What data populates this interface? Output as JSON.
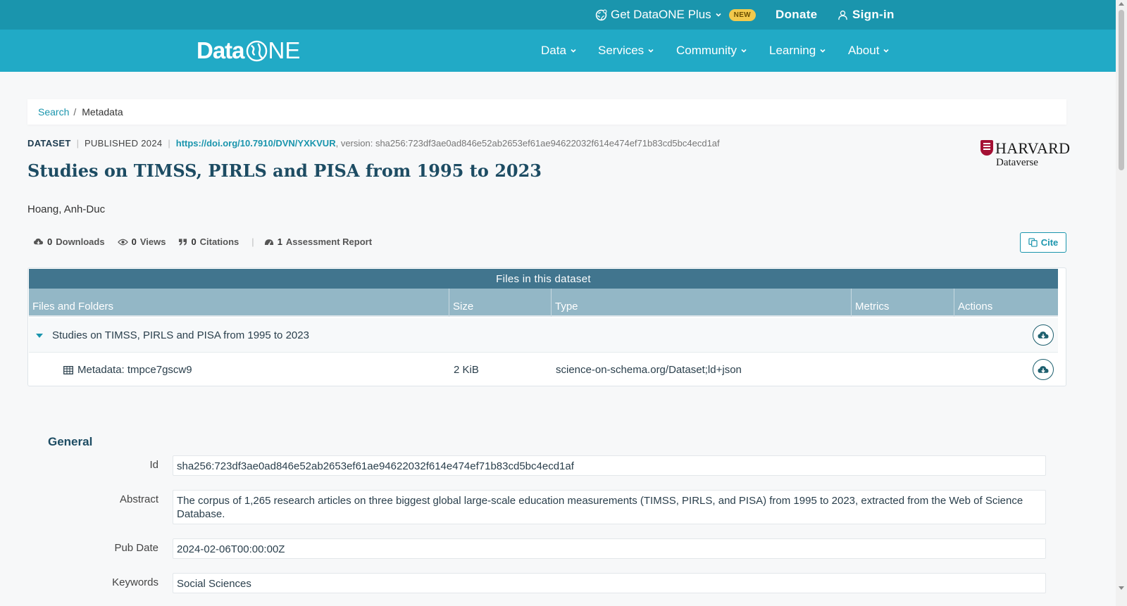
{
  "topbar": {
    "plus_label": "Get DataONE Plus",
    "new_badge": "NEW",
    "donate_label": "Donate",
    "signin_label": "Sign-in"
  },
  "navbar": {
    "logo_prefix": "Data",
    "logo_suffix": "NE",
    "items": [
      {
        "label": "Data"
      },
      {
        "label": "Services"
      },
      {
        "label": "Community"
      },
      {
        "label": "Learning"
      },
      {
        "label": "About"
      }
    ]
  },
  "breadcrumb": {
    "search": "Search",
    "separator": "/",
    "current": "Metadata"
  },
  "dataset": {
    "type": "DATASET",
    "published": "PUBLISHED 2024",
    "doi": "https://doi.org/10.7910/DVN/YXKVUR",
    "version": ", version: sha256:723df3ae0ad846e52ab2653ef61ae94622032f614e474ef71b83cd5bc4ecd1af",
    "title": "Studies on TIMSS, PIRLS and PISA from 1995 to 2023",
    "author": "Hoang, Anh-Duc",
    "repository": {
      "name": "HARVARD",
      "sub": "Dataverse"
    }
  },
  "metrics": {
    "downloads_count": "0",
    "downloads_label": "Downloads",
    "views_count": "0",
    "views_label": "Views",
    "citations_count": "0",
    "citations_label": "Citations",
    "assessment_count": "1",
    "assessment_label": "Assessment Report"
  },
  "cite_label": "Cite",
  "files": {
    "title": "Files in this dataset",
    "columns": [
      "Files and Folders",
      "Size",
      "Type",
      "Metrics",
      "Actions"
    ],
    "folder": {
      "name": "Studies on TIMSS, PIRLS and PISA from 1995 to 2023"
    },
    "file": {
      "name": "Metadata: tmpce7gscw9",
      "size": "2 KiB",
      "type": "science-on-schema.org/Dataset;ld+json"
    }
  },
  "general": {
    "title": "General",
    "fields": [
      {
        "label": "Id",
        "value": "sha256:723df3ae0ad846e52ab2653ef61ae94622032f614e474ef71b83cd5bc4ecd1af"
      },
      {
        "label": "Abstract",
        "value": "The corpus of 1,265 research articles on three biggest global large-scale education measurements (TIMSS, PIRLS, and PISA) from 1995 to 2023, extracted from the Web of Science Database."
      },
      {
        "label": "Pub Date",
        "value": "2024-02-06T00:00:00Z"
      },
      {
        "label": "Keywords",
        "value": "Social Sciences"
      }
    ]
  },
  "colors": {
    "topbar": "#1a95ad",
    "navbar": "#21aac6",
    "accent": "#1a95ad",
    "title": "#1d4c63",
    "table_header": "#41758e"
  },
  "icons": [
    "globe-icon",
    "chevron-down-icon",
    "user-icon",
    "cloud-download-icon",
    "eye-icon",
    "quote-icon",
    "gauge-icon",
    "copy-icon",
    "table-icon",
    "caret-down-icon"
  ]
}
